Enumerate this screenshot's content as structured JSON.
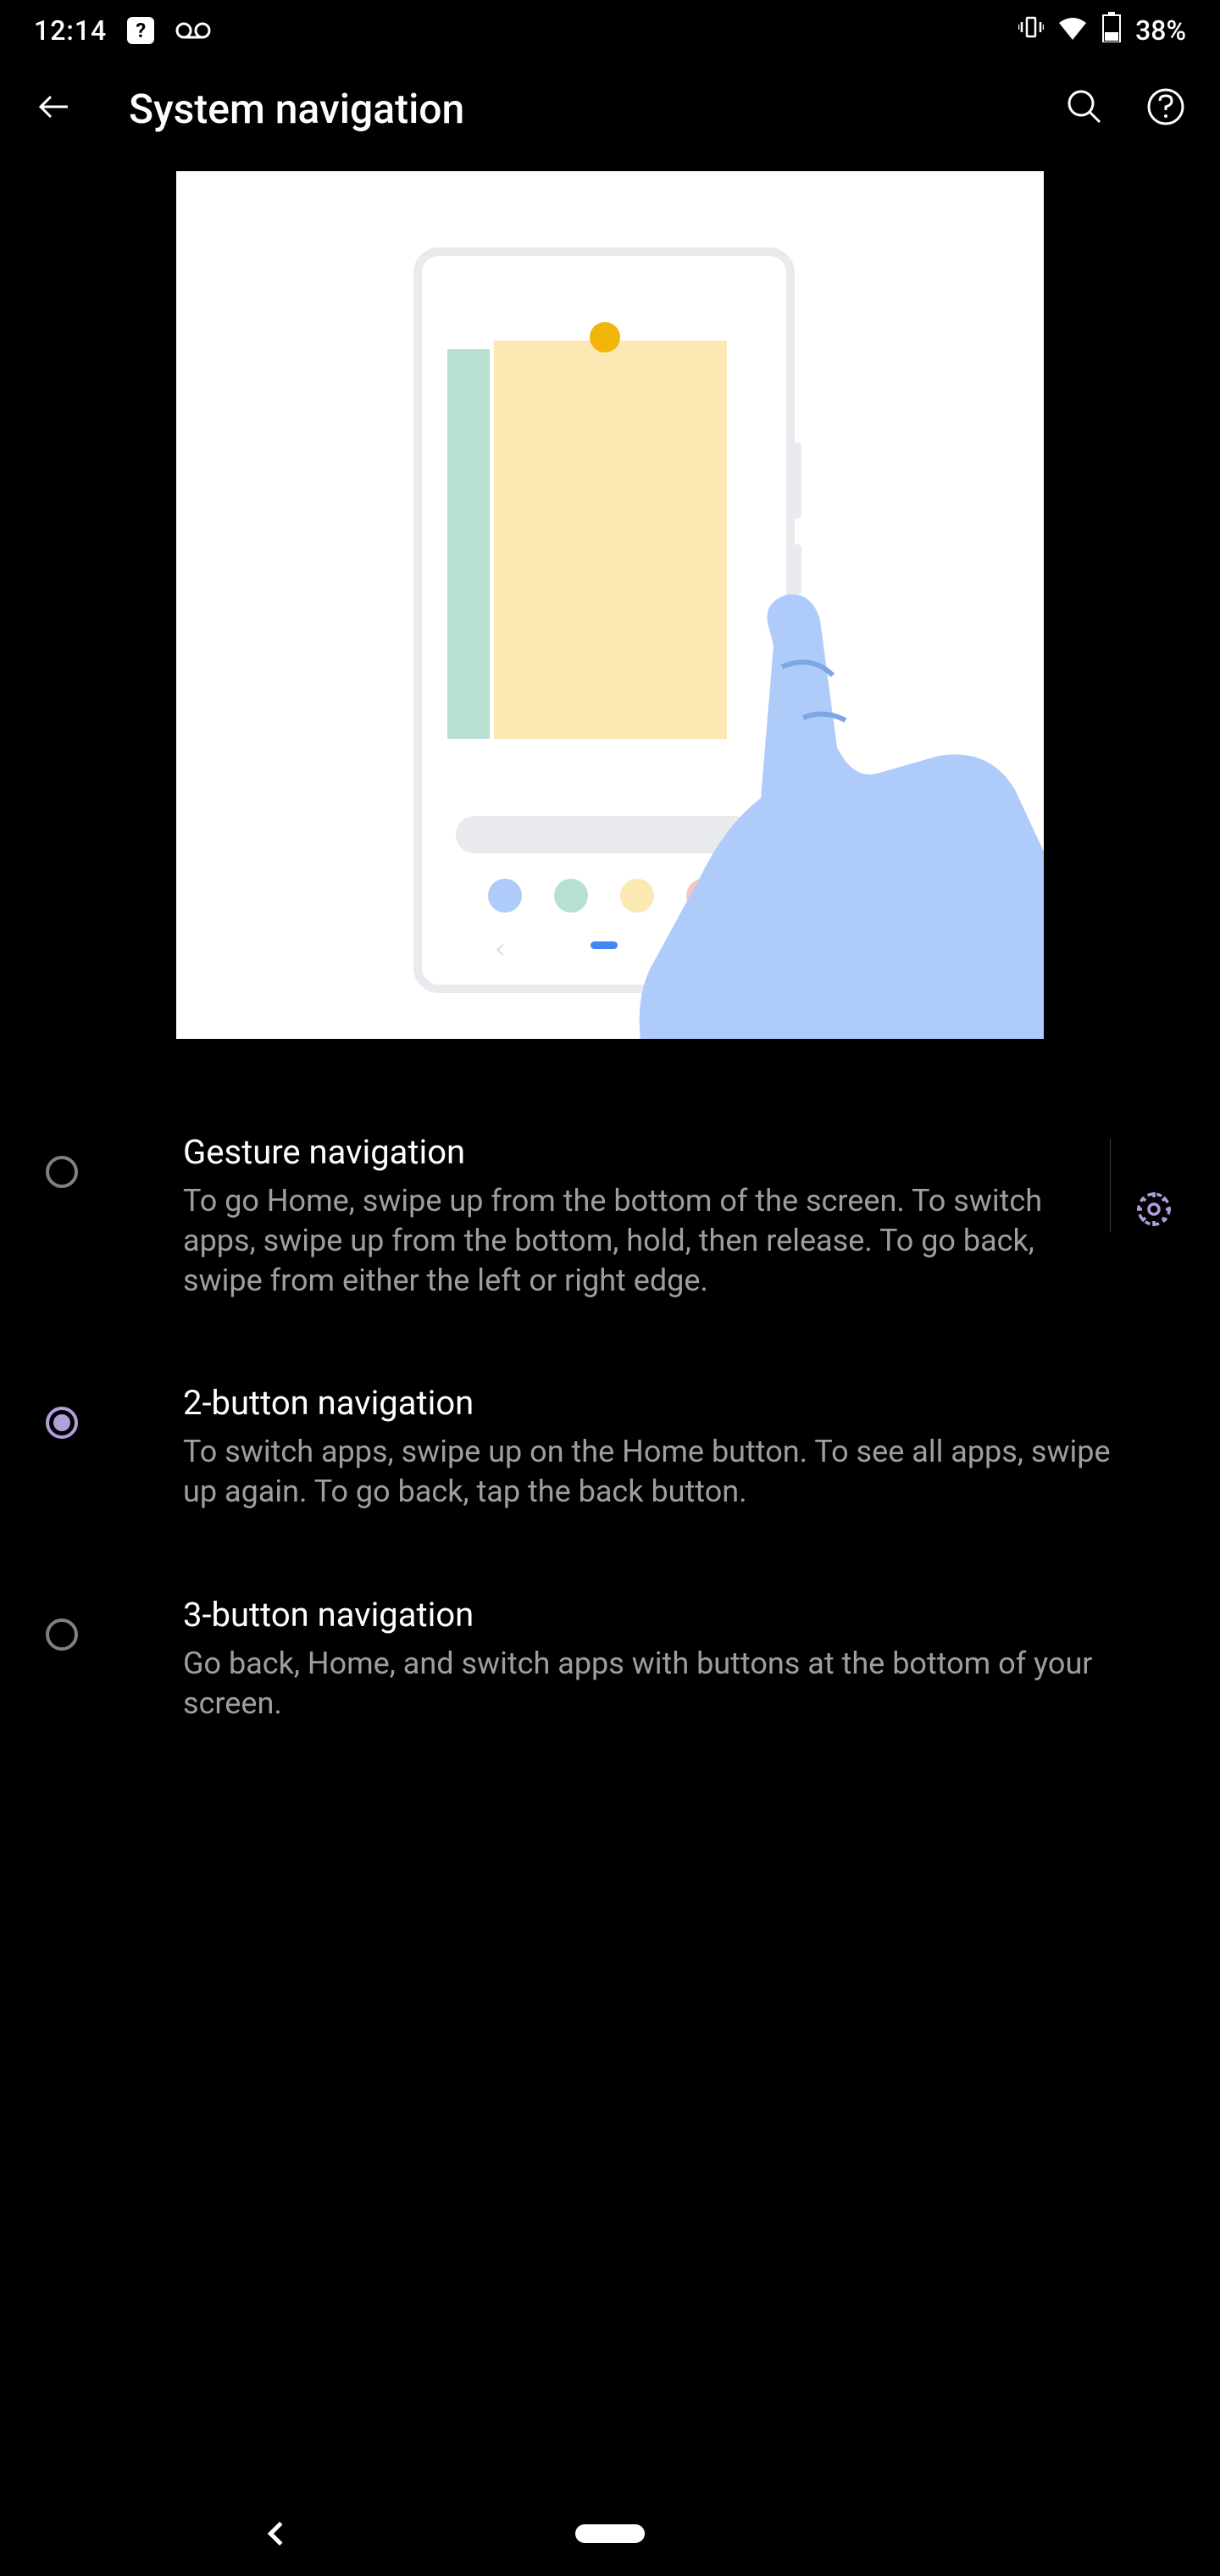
{
  "status_bar": {
    "clock": "12:14",
    "battery": "38%"
  },
  "app_bar": {
    "title": "System navigation"
  },
  "options": [
    {
      "title": "Gesture navigation",
      "description": "To go Home, swipe up from the bottom of the screen. To switch apps, swipe up from the bottom, hold, then release. To go back, swipe from either the left or right edge.",
      "selected": false,
      "has_settings": true
    },
    {
      "title": "2-button navigation",
      "description": "To switch apps, swipe up on the Home button. To see all apps, swipe up again. To go back, tap the back button.",
      "selected": true,
      "has_settings": false
    },
    {
      "title": "3-button navigation",
      "description": "Go back, Home, and switch apps with buttons at the bottom of your screen.",
      "selected": false,
      "has_settings": false
    }
  ]
}
